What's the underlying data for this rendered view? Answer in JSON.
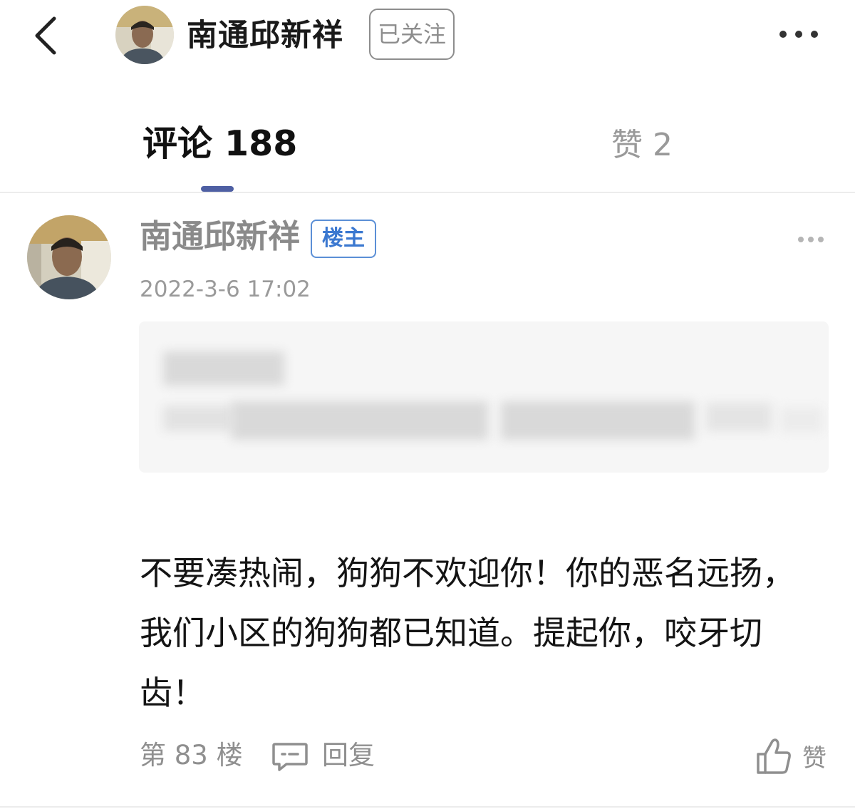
{
  "header": {
    "user_name": "南通邱新祥",
    "follow_label": "已关注"
  },
  "tabs": [
    {
      "label": "评论 188",
      "active": true
    },
    {
      "label": "赞 2",
      "active": false
    }
  ],
  "comment": {
    "author": "南通邱新祥",
    "badge": "楼主",
    "time": "2022-3-6 17:02",
    "body": "不要凑热闹，狗狗不欢迎你！你的恶名远扬，我们小区的狗狗都已知道。提起你，咬牙切齿！",
    "floor": "第 83 楼",
    "reply_label": "回复",
    "like_label": "赞"
  },
  "colors": {
    "accent": "#4e5fa3",
    "badge": "#3b78d0",
    "muted": "#8f8f8f"
  },
  "icons": [
    "back-arrow-icon",
    "more-dots-icon",
    "reply-icon",
    "thumbs-up-icon"
  ]
}
